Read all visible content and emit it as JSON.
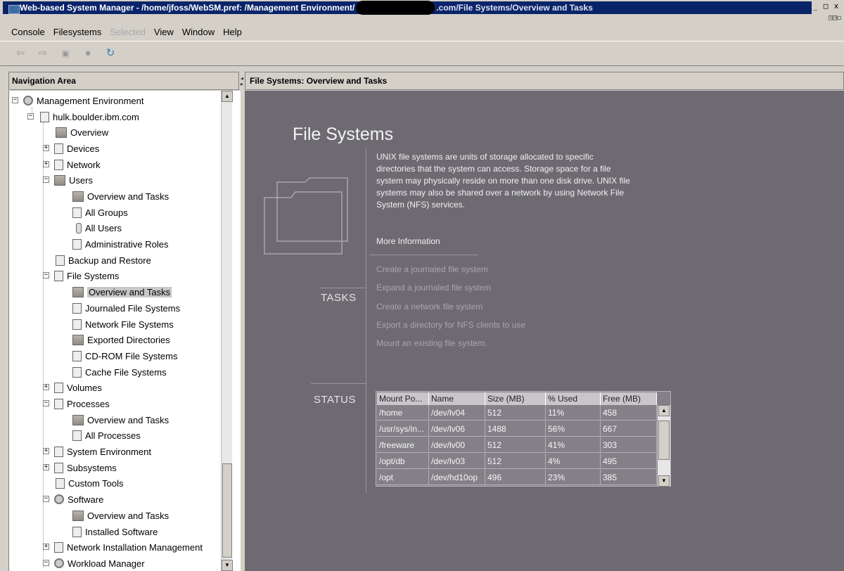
{
  "window": {
    "title_part1": "Web-based System Manager - /home/jfoss/WebSM.pref: /Management Environment/",
    "title_part2": ".com/File Systems/Overview and Tasks",
    "min": "_",
    "max": "□",
    "close": "x"
  },
  "menu": [
    "Console",
    "Filesystems",
    "Selected",
    "View",
    "Window",
    "Help"
  ],
  "nav": {
    "header": "Navigation Area",
    "items": [
      {
        "label": "Management Environment"
      },
      {
        "label": "hulk.boulder.ibm.com"
      },
      {
        "label": "Overview"
      },
      {
        "label": "Devices"
      },
      {
        "label": "Network"
      },
      {
        "label": "Users"
      },
      {
        "label": "Overview and Tasks"
      },
      {
        "label": "All Groups"
      },
      {
        "label": "All Users"
      },
      {
        "label": "Administrative Roles"
      },
      {
        "label": "Backup and Restore"
      },
      {
        "label": "File Systems"
      },
      {
        "label": "Overview and Tasks"
      },
      {
        "label": "Journaled File Systems"
      },
      {
        "label": "Network File Systems"
      },
      {
        "label": "Exported Directories"
      },
      {
        "label": "CD-ROM File Systems"
      },
      {
        "label": "Cache File Systems"
      },
      {
        "label": "Volumes"
      },
      {
        "label": "Processes"
      },
      {
        "label": "Overview and Tasks"
      },
      {
        "label": "All Processes"
      },
      {
        "label": "System Environment"
      },
      {
        "label": "Subsystems"
      },
      {
        "label": "Custom Tools"
      },
      {
        "label": "Software"
      },
      {
        "label": "Overview and Tasks"
      },
      {
        "label": "Installed Software"
      },
      {
        "label": "Network Installation Management"
      },
      {
        "label": "Workload Manager"
      }
    ]
  },
  "content": {
    "header": "File Systems: Overview and Tasks",
    "title": "File Systems",
    "description": "UNIX file systems are units of storage allocated to specific directories that the system can access. Storage space for a file system may physically reside on more than one disk drive. UNIX file systems may also be shared over a network by using Network File System (NFS) services.",
    "more_info": "More Information",
    "tasks_label": "TASKS",
    "tasks": [
      "Create a journaled file system",
      "Expand a journaled file system",
      "Create a network file system",
      "Export a directory for NFS clients to use",
      "Mount an existing file system."
    ],
    "status_label": "STATUS",
    "status_table": {
      "columns": [
        "Mount Po...",
        "Name",
        "Size (MB)",
        "% Used",
        "Free (MB)"
      ],
      "rows": [
        [
          "/home",
          "/dev/lv04",
          "512",
          "11%",
          "458"
        ],
        [
          "/usr/sys/in...",
          "/dev/lv06",
          "1488",
          "56%",
          "667"
        ],
        [
          "/freeware",
          "/dev/lv00",
          "512",
          "41%",
          "303"
        ],
        [
          "/opt/db",
          "/dev/lv03",
          "512",
          "4%",
          "495"
        ],
        [
          "/opt",
          "/dev/hd10op",
          "496",
          "23%",
          "385"
        ]
      ]
    }
  }
}
